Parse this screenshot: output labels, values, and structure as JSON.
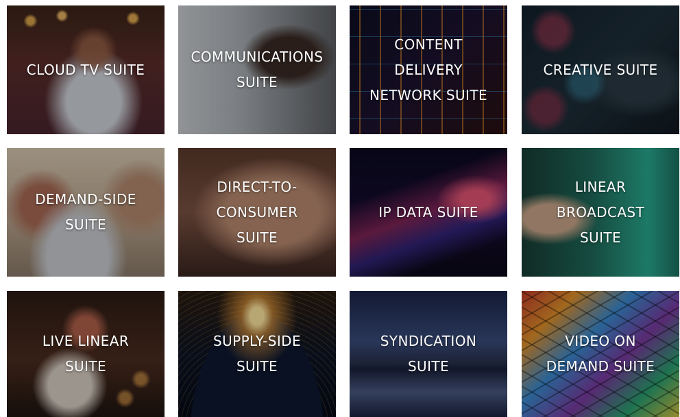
{
  "tiles": [
    {
      "label": "CLOUD TV SUITE"
    },
    {
      "label": "COMMUNICATIONS\nSUITE"
    },
    {
      "label": "CONTENT\nDELIVERY\nNETWORK SUITE"
    },
    {
      "label": "CREATIVE SUITE"
    },
    {
      "label": "DEMAND-SIDE\nSUITE"
    },
    {
      "label": "DIRECT-TO-\nCONSUMER\nSUITE"
    },
    {
      "label": "IP DATA SUITE"
    },
    {
      "label": "LINEAR\nBROADCAST\nSUITE"
    },
    {
      "label": "LIVE LINEAR\nSUITE"
    },
    {
      "label": "SUPPLY-SIDE\nSUITE"
    },
    {
      "label": "SYNDICATION\nSUITE"
    },
    {
      "label": "VIDEO ON\nDEMAND SUITE"
    }
  ]
}
